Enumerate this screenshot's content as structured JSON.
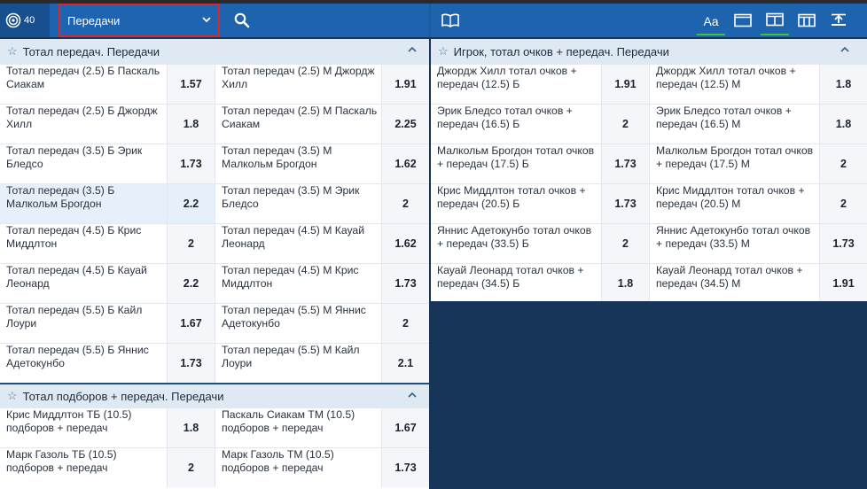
{
  "toolbar": {
    "count": "40",
    "dropdown_label": "Передачи",
    "aa_label": "Aa"
  },
  "left_sections": [
    {
      "title": "Тотал передач. Передачи",
      "rows": [
        {
          "a_name": "Тотал передач (2.5) Б Паскаль Сиакам",
          "a_odd": "1.57",
          "b_name": "Тотал передач (2.5) М Джордж Хилл",
          "b_odd": "1.91"
        },
        {
          "a_name": "Тотал передач (2.5) Б Джордж Хилл",
          "a_odd": "1.8",
          "b_name": "Тотал передач (2.5) М Паскаль Сиакам",
          "b_odd": "2.25"
        },
        {
          "a_name": "Тотал передач (3.5) Б Эрик Бледсо",
          "a_odd": "1.73",
          "b_name": "Тотал передач (3.5) М Малкольм Брогдон",
          "b_odd": "1.62"
        },
        {
          "a_name": "Тотал передач (3.5) Б Малкольм Брогдон",
          "a_odd": "2.2",
          "b_name": "Тотал передач (3.5) М Эрик Бледсо",
          "b_odd": "2"
        },
        {
          "a_name": "Тотал передач (4.5) Б Крис Миддлтон",
          "a_odd": "2",
          "b_name": "Тотал передач (4.5) М Кауай Леонард",
          "b_odd": "1.62"
        },
        {
          "a_name": "Тотал передач (4.5) Б Кауай Леонард",
          "a_odd": "2.2",
          "b_name": "Тотал передач (4.5) М Крис Миддлтон",
          "b_odd": "1.73"
        },
        {
          "a_name": "Тотал передач (5.5) Б Кайл Лоури",
          "a_odd": "1.67",
          "b_name": "Тотал передач (5.5) М Яннис Адетокунбо",
          "b_odd": "2"
        },
        {
          "a_name": "Тотал передач (5.5) Б Яннис Адетокунбо",
          "a_odd": "1.73",
          "b_name": "Тотал передач (5.5) М Кайл Лоури",
          "b_odd": "2.1"
        }
      ]
    },
    {
      "title": "Тотал подборов + передач. Передачи",
      "rows": [
        {
          "a_name": "Крис Миддлтон ТБ (10.5) подборов + передач",
          "a_odd": "1.8",
          "b_name": "Паскаль Сиакам ТМ (10.5) подборов + передач",
          "b_odd": "1.67"
        },
        {
          "a_name": "Марк Газоль ТБ (10.5) подборов + передач",
          "a_odd": "2",
          "b_name": "Марк Газоль ТМ (10.5) подборов + передач",
          "b_odd": "1.73"
        }
      ]
    }
  ],
  "right_section": {
    "title": "Игрок, тотал очков + передач. Передачи",
    "rows": [
      {
        "a_name": "Джордж Хилл тотал очков + передач (12.5) Б",
        "a_odd": "1.91",
        "b_name": "Джордж Хилл тотал очков + передач (12.5) М",
        "b_odd": "1.8"
      },
      {
        "a_name": "Эрик Бледсо тотал очков + передач (16.5) Б",
        "a_odd": "2",
        "b_name": "Эрик Бледсо тотал очков + передач (16.5) М",
        "b_odd": "1.8"
      },
      {
        "a_name": "Малкольм Брогдон тотал очков + передач (17.5) Б",
        "a_odd": "1.73",
        "b_name": "Малкольм Брогдон тотал очков + передач (17.5) М",
        "b_odd": "2"
      },
      {
        "a_name": "Крис Миддлтон тотал очков + передач (20.5) Б",
        "a_odd": "1.73",
        "b_name": "Крис Миддлтон тотал очков + передач (20.5) М",
        "b_odd": "2"
      },
      {
        "a_name": "Яннис Адетокунбо тотал очков + передач (33.5) Б",
        "a_odd": "2",
        "b_name": "Яннис Адетокунбо тотал очков + передач (33.5) М",
        "b_odd": "1.73"
      },
      {
        "a_name": "Кауай Леонард тотал очков + передач (34.5) Б",
        "a_odd": "1.8",
        "b_name": "Кауай Леонард тотал очков + передач (34.5) М",
        "b_odd": "1.91"
      }
    ]
  },
  "colors": {
    "toolbar_blue": "#1d63ae",
    "page_background": "#173558",
    "section_header": "#dfe9f4",
    "dropdown_border": "#d7282f",
    "active_indicator": "#3fc13f"
  },
  "icons": {
    "count_icon": "target-icon",
    "search": "search-icon",
    "book": "book-icon",
    "font_size": "font-size-icon",
    "view_single": "view-single-icon",
    "view_two_columns": "view-two-columns-icon",
    "view_three_columns": "view-three-columns-icon",
    "collapse_all": "collapse-all-icon",
    "favorite": "star-icon",
    "collapse": "chevron-up-icon",
    "dropdown": "chevron-down-icon"
  }
}
